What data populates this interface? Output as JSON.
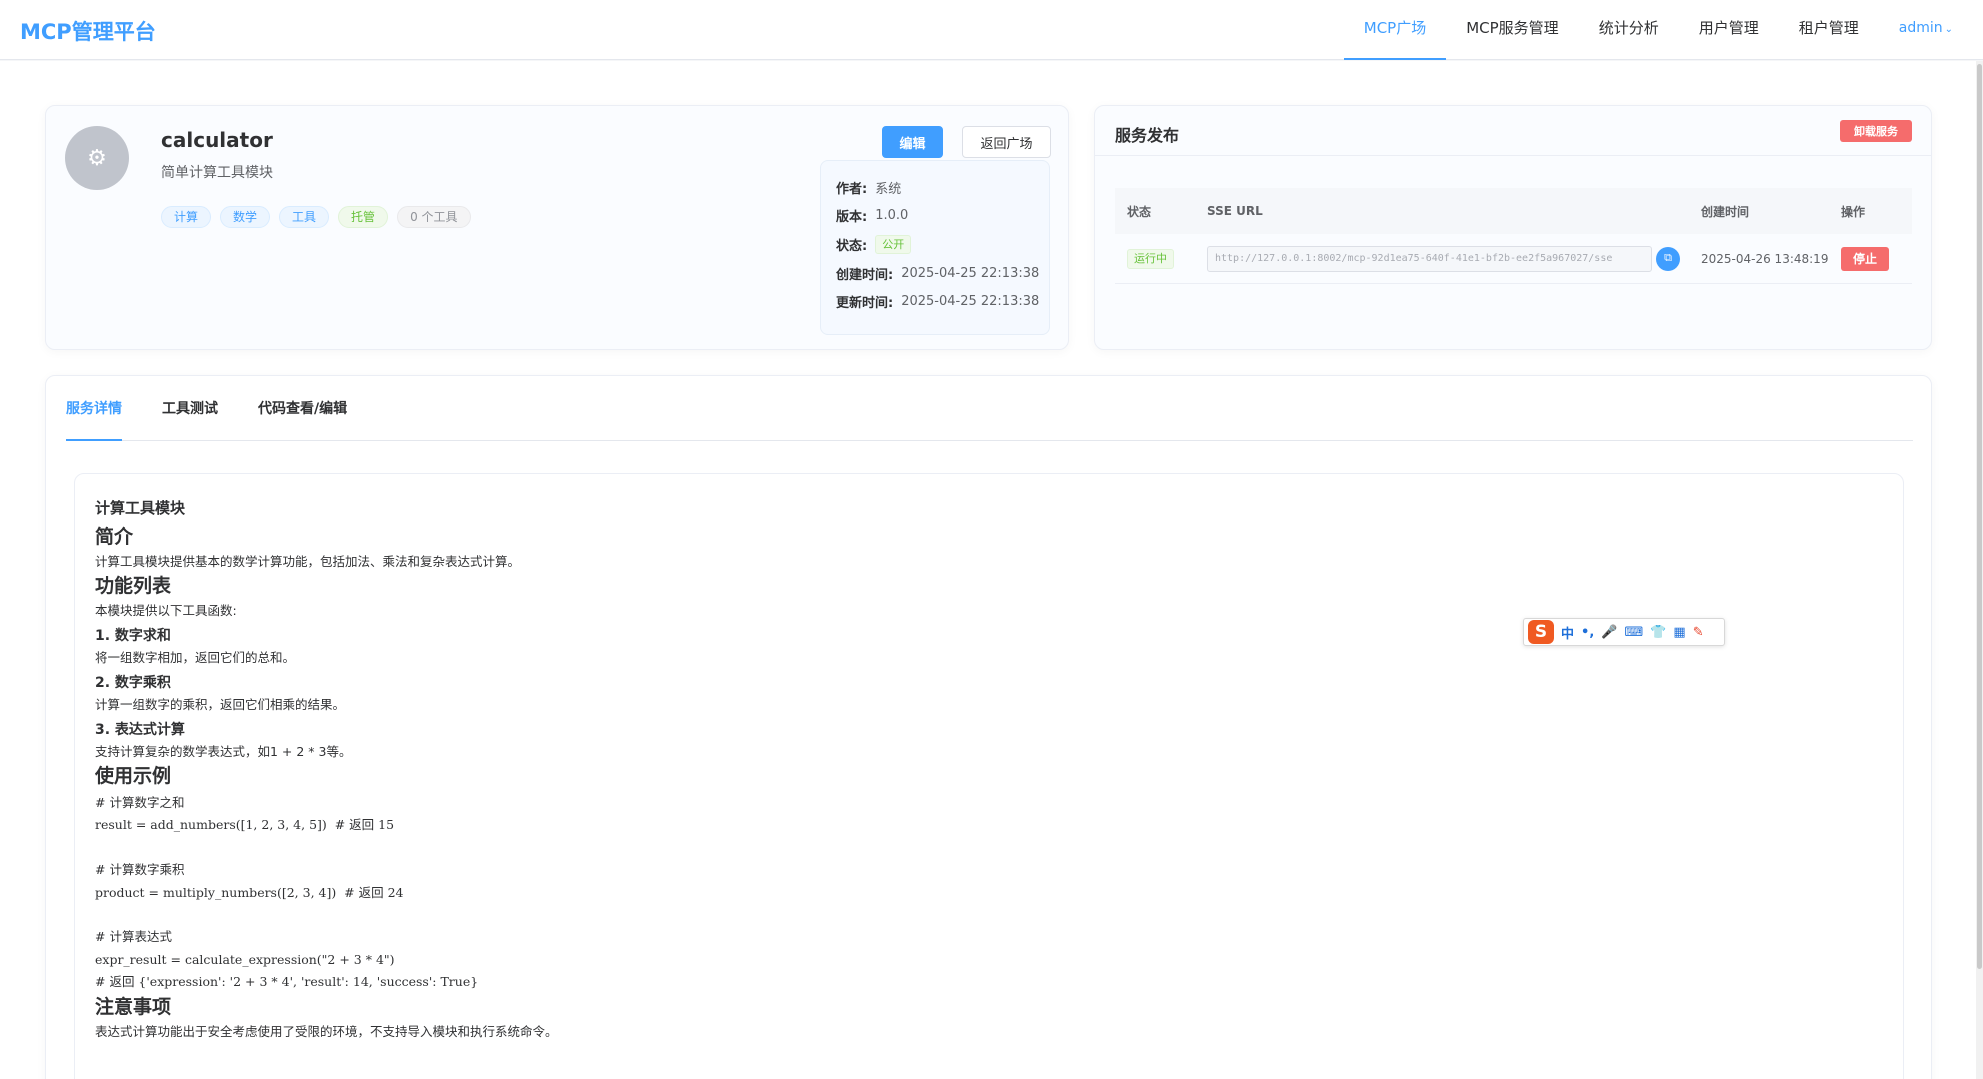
{
  "header": {
    "brand": "MCP管理平台",
    "nav": [
      "MCP广场",
      "MCP服务管理",
      "统计分析",
      "用户管理",
      "租户管理"
    ],
    "active_nav": "MCP广场",
    "user": "admin"
  },
  "service": {
    "name": "calculator",
    "description": "简单计算工具模块",
    "tags": [
      "计算",
      "数学",
      "工具",
      "托管",
      "0 个工具"
    ],
    "edit_label": "编辑",
    "back_label": "返回广场",
    "meta": {
      "author_label": "作者:",
      "author": "系统",
      "version_label": "版本:",
      "version": "1.0.0",
      "status_label": "状态:",
      "status": "公开",
      "created_label": "创建时间:",
      "created": "2025-04-25 22:13:38",
      "updated_label": "更新时间:",
      "updated": "2025-04-25 22:13:38"
    }
  },
  "publish": {
    "title": "服务发布",
    "unload_label": "卸载服务",
    "columns": [
      "状态",
      "SSE URL",
      "创建时间",
      "操作"
    ],
    "row": {
      "status": "运行中",
      "url": "http://127.0.0.1:8002/mcp-92d1ea75-640f-41e1-bf2b-ee2f5a967027/sse",
      "created": "2025-04-26 13:48:19",
      "action": "停止"
    }
  },
  "tabs": [
    "服务详情",
    "工具测试",
    "代码查看/编辑"
  ],
  "active_tab": "服务详情",
  "doc": {
    "title": "计算工具模块",
    "h_intro": "简介",
    "intro": "计算工具模块提供基本的数学计算功能，包括加法、乘法和复杂表达式计算。",
    "h_features": "功能列表",
    "features_intro": "本模块提供以下工具函数:",
    "f1_title": "1. 数字求和",
    "f1_desc": "将一组数字相加，返回它们的总和。",
    "f2_title": "2. 数字乘积",
    "f2_desc": "计算一组数字的乘积，返回它们相乘的结果。",
    "f3_title": "3. 表达式计算",
    "f3_desc": "支持计算复杂的数学表达式，如1 + 2 * 3等。",
    "h_examples": "使用示例",
    "code": "# 计算数字之和\nresult = add_numbers([1, 2, 3, 4, 5])  # 返回 15\n\n# 计算数字乘积\nproduct = multiply_numbers([2, 3, 4])  # 返回 24\n\n# 计算表达式\nexpr_result = calculate_expression(\"2 + 3 * 4\")\n# 返回 {'expression': '2 + 3 * 4', 'result': 14, 'success': True}",
    "h_notes": "注意事项",
    "notes": "表达式计算功能出于安全考虑使用了受限的环境，不支持导入模块和执行系统命令。"
  },
  "ime": {
    "logo": "S",
    "items": [
      "中",
      "•,",
      "🎤",
      "⌨",
      "👕",
      "▦",
      "✎"
    ]
  },
  "colors": {
    "primary": "#409eff",
    "danger": "#f56c6c",
    "success": "#67c23a"
  }
}
